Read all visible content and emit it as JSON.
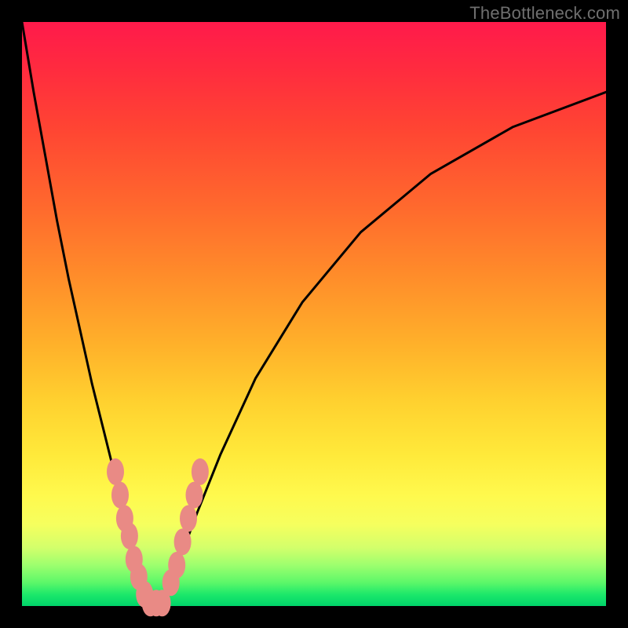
{
  "watermark": "TheBottleneck.com",
  "chart_data": {
    "type": "line",
    "title": "",
    "xlabel": "",
    "ylabel": "",
    "xlim": [
      0,
      100
    ],
    "ylim": [
      0,
      100
    ],
    "series": [
      {
        "name": "bottleneck-curve",
        "x": [
          0,
          2,
          4,
          6,
          8,
          10,
          12,
          14,
          16,
          17,
          18,
          19,
          20,
          21,
          22,
          23,
          24,
          25,
          27,
          30,
          34,
          40,
          48,
          58,
          70,
          84,
          100
        ],
        "y": [
          100,
          88,
          77,
          66,
          56,
          47,
          38,
          30,
          22,
          18,
          14,
          10,
          6,
          3,
          1,
          0,
          1,
          3,
          8,
          16,
          26,
          39,
          52,
          64,
          74,
          82,
          88
        ]
      }
    ],
    "markers": {
      "name": "highlight-dots",
      "color": "#e98a85",
      "points": [
        {
          "x": 16.0,
          "y": 23
        },
        {
          "x": 16.8,
          "y": 19
        },
        {
          "x": 17.6,
          "y": 15
        },
        {
          "x": 18.4,
          "y": 12
        },
        {
          "x": 19.2,
          "y": 8
        },
        {
          "x": 20.0,
          "y": 5
        },
        {
          "x": 21.0,
          "y": 2
        },
        {
          "x": 22.0,
          "y": 0.5
        },
        {
          "x": 23.0,
          "y": 0.5
        },
        {
          "x": 24.0,
          "y": 0.5
        },
        {
          "x": 25.5,
          "y": 4
        },
        {
          "x": 26.5,
          "y": 7
        },
        {
          "x": 27.5,
          "y": 11
        },
        {
          "x": 28.5,
          "y": 15
        },
        {
          "x": 29.5,
          "y": 19
        },
        {
          "x": 30.5,
          "y": 23
        }
      ]
    },
    "gradient_stops": [
      {
        "pos": 0.0,
        "color": "#ff1a4b"
      },
      {
        "pos": 0.25,
        "color": "#ff5a30"
      },
      {
        "pos": 0.5,
        "color": "#ffb02a"
      },
      {
        "pos": 0.75,
        "color": "#fff446"
      },
      {
        "pos": 0.92,
        "color": "#b0ff6c"
      },
      {
        "pos": 1.0,
        "color": "#00d46a"
      }
    ]
  }
}
